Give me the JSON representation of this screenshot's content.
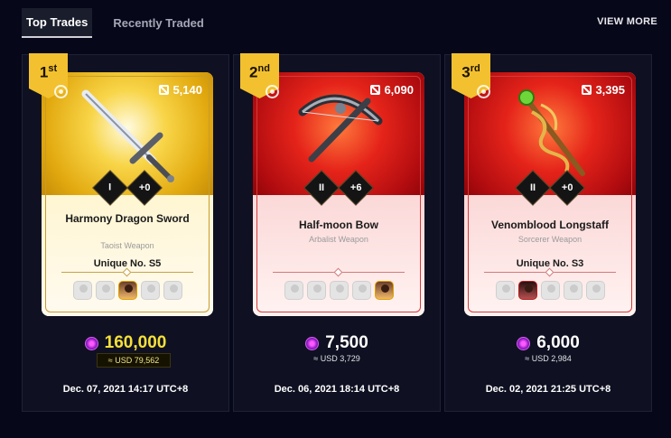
{
  "tabs": [
    {
      "label": "Top Trades",
      "active": true
    },
    {
      "label": "Recently Traded",
      "active": false
    }
  ],
  "view_more_label": "VIEW MORE",
  "colors": {
    "gold_price": "#f6e03a",
    "badge": "#f3c12f",
    "card_red": "#e5241a",
    "card_gold": "#f8d548"
  },
  "trades": [
    {
      "rank": "1",
      "rank_suffix": "st",
      "theme": "gold",
      "collectors": "5,140",
      "stat_tier": "I",
      "stat_plus": "+0",
      "name": "Harmony Dragon Sword",
      "class": "Taoist Weapon",
      "unique": "Unique No. S5",
      "price": "160,000",
      "usd": "≈ USD 79,562",
      "date": "Dec. 07, 2021 14:17 UTC+8",
      "weapon_icon": "sword-icon"
    },
    {
      "rank": "2",
      "rank_suffix": "nd",
      "theme": "red",
      "collectors": "6,090",
      "stat_tier": "II",
      "stat_plus": "+6",
      "name": "Half-moon Bow",
      "class": "Arbalist Weapon",
      "unique": "",
      "price": "7,500",
      "usd": "≈ USD 3,729",
      "date": "Dec. 06, 2021 18:14 UTC+8",
      "weapon_icon": "crossbow-icon"
    },
    {
      "rank": "3",
      "rank_suffix": "rd",
      "theme": "red",
      "collectors": "3,395",
      "stat_tier": "II",
      "stat_plus": "+0",
      "name": "Venomblood Longstaff",
      "class": "Sorcerer Weapon",
      "unique": "Unique No. S3",
      "price": "6,000",
      "usd": "≈ USD 2,984",
      "date": "Dec. 02, 2021 21:25 UTC+8",
      "weapon_icon": "staff-icon"
    }
  ]
}
